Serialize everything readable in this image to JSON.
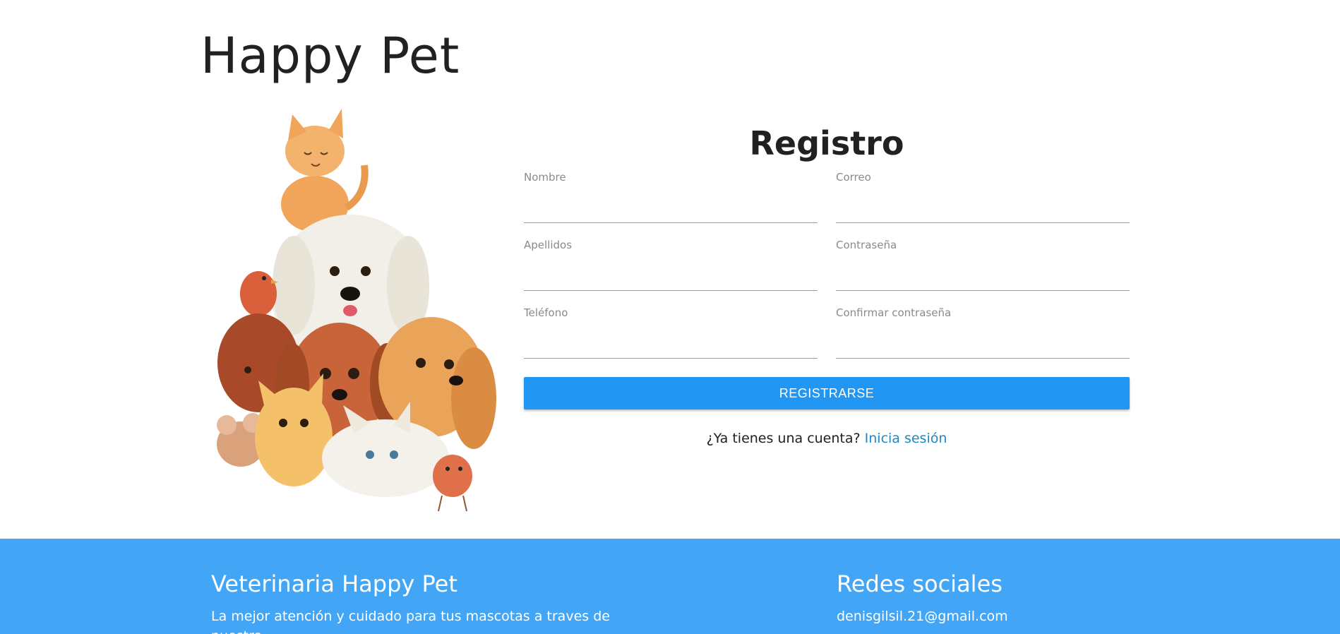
{
  "brand": {
    "title": "Happy Pet"
  },
  "form": {
    "title": "Registro",
    "fields": {
      "nombre": {
        "label": "Nombre",
        "value": ""
      },
      "correo": {
        "label": "Correo",
        "value": ""
      },
      "apellidos": {
        "label": "Apellidos",
        "value": ""
      },
      "contrasena": {
        "label": "Contraseña",
        "value": ""
      },
      "telefono": {
        "label": "Teléfono",
        "value": ""
      },
      "confirmar": {
        "label": "Confirmar contraseña",
        "value": ""
      }
    },
    "submit_label": "REGISTRARSE",
    "login_prompt": "¿Ya tienes una cuenta?",
    "login_link": "Inicia sesión"
  },
  "footer": {
    "left": {
      "heading": "Veterinaria Happy Pet",
      "text": "La mejor atención y cuidado para tus mascotas a traves de nuestra"
    },
    "right": {
      "heading": "Redes sociales",
      "email": "denisgilsil.21@gmail.com"
    }
  },
  "colors": {
    "primary_button": "#2196f3",
    "footer_bg": "#42a5f5",
    "link": "#1e88c7"
  },
  "icons": {
    "illustration": "pets-group-illustration"
  }
}
